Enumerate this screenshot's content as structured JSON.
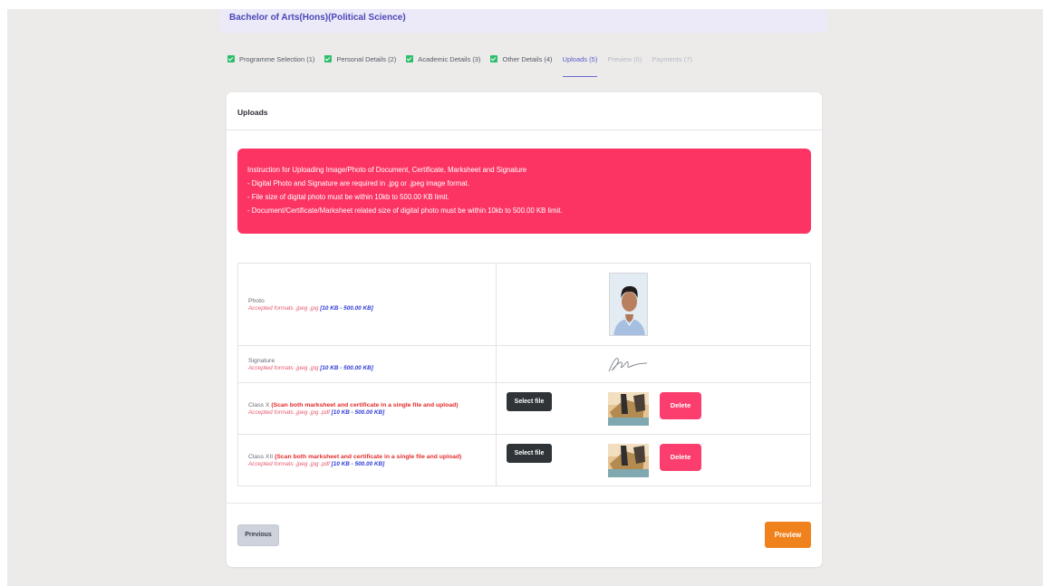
{
  "program": {
    "title": "Bachelor of Arts(Hons)(Political Science)"
  },
  "steps": [
    {
      "label": "Programme Selection",
      "num": "(1)",
      "state": "done"
    },
    {
      "label": "Personal Details",
      "num": "(2)",
      "state": "done"
    },
    {
      "label": "Academic Details",
      "num": "(3)",
      "state": "done"
    },
    {
      "label": "Other Details",
      "num": "(4)",
      "state": "done"
    },
    {
      "label": "Uploads",
      "num": "(5)",
      "state": "active"
    },
    {
      "label": "Preview",
      "num": "(6)",
      "state": "disabled"
    },
    {
      "label": "Payments",
      "num": "(7)",
      "state": "disabled"
    }
  ],
  "card": {
    "title": "Uploads"
  },
  "instructions": {
    "heading": "Instruction for Uploading Image/Photo of Document, Certificate, Marksheet and Signature",
    "lines": [
      "- Digital Photo and Signature are required in .jpg or .jpeg image format.",
      "- File size of digital photo must be within 10kb to 500.00 KB limit.",
      "- Document/Certificate/Marksheet related size of digital photo must be within 10kb to 500.00 KB limit."
    ]
  },
  "documents": [
    {
      "name": "Photo",
      "note": "",
      "formats": "Accepted formats .jpeg .jpg",
      "size": "[10 KB - 500.00 KB]"
    },
    {
      "name": "Signature",
      "note": "",
      "formats": "Accepted formats .jpeg .jpg",
      "size": "[10 KB - 500.00 KB]"
    },
    {
      "name": "Class X",
      "note": "(Scan both marksheet and certificate in a single file and upload)",
      "formats": "Accepted formats .jpeg .jpg .pdf",
      "size": "[10 KB - 500.00 KB]",
      "select_label": "Select file",
      "delete_label": "Delete"
    },
    {
      "name": "Class XII",
      "note": "(Scan both marksheet and certificate in a single file and upload)",
      "formats": "Accepted formats .jpeg .jpg .pdf",
      "size": "[10 KB - 500.00 KB]",
      "select_label": "Select file",
      "delete_label": "Delete"
    }
  ],
  "buttons": {
    "previous": "Previous",
    "preview": "Preview"
  },
  "colors": {
    "accent": "#5c59c9",
    "alert": "#fc3463",
    "check": "#2dbf6b",
    "delete": "#fb3e6d",
    "preview": "#f0821e"
  }
}
